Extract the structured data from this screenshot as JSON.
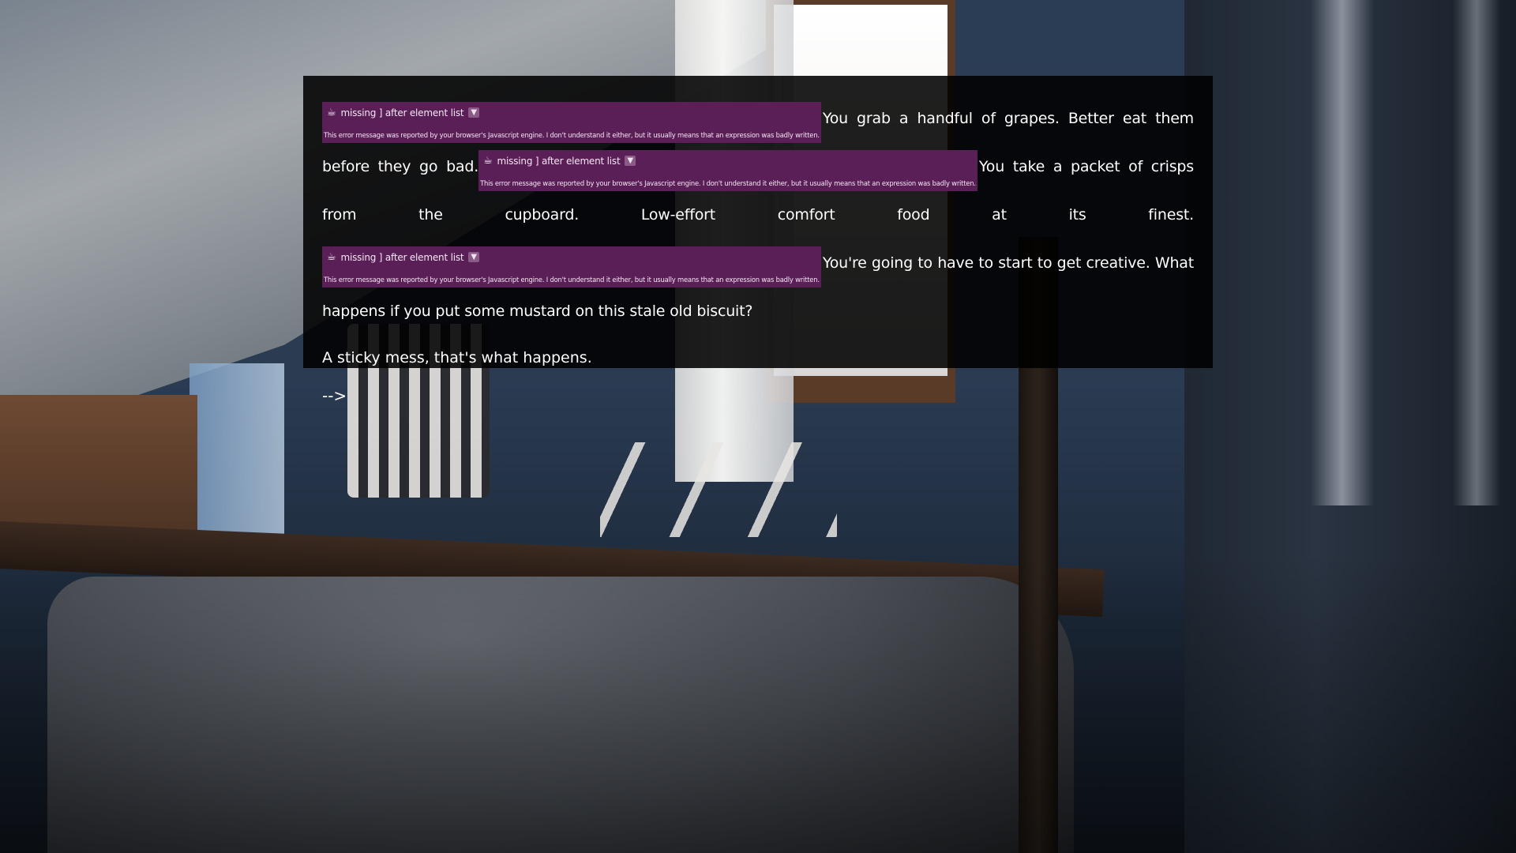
{
  "passage": {
    "error_title": "missing ] after element list",
    "error_toggle": "▼",
    "error_detail": "This error message was reported by your browser's Javascript engine. I don't understand it either, but it usually means that an expression was badly written.",
    "text_1": "You grab a handful of grapes. Better eat them before they go bad.",
    "text_2": "You take a packet of crisps from the cupboard. Low-effort comfort food at its finest.",
    "text_3": "You're going to have to start to get creative. What happens if you put some mustard on this stale old biscuit?",
    "text_4": "A sticky mess, that's what happens.",
    "next_link": "-->"
  },
  "icons": {
    "error_icon": "coffee-cup-icon",
    "error_icon_glyph": "☕"
  },
  "colors": {
    "error_bg": "#5a1f57",
    "passage_bg": "rgba(0,0,0,0.88)",
    "text": "#ffffff"
  }
}
